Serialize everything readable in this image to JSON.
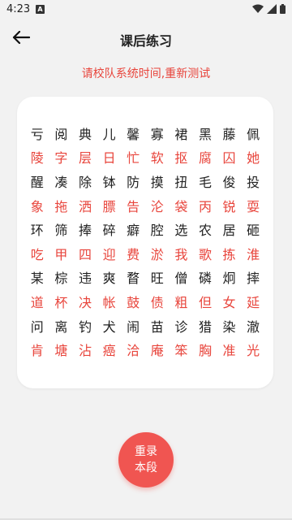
{
  "status_bar": {
    "time": "4:23",
    "notification_badge": "A",
    "icons": [
      "wifi-icon",
      "signal-icon",
      "battery-icon"
    ]
  },
  "header": {
    "title": "课后练习",
    "back_icon": "arrow-left-icon"
  },
  "instruction": "请校队系统时间,重新测试",
  "colors": {
    "accent": "#f05551",
    "red_text": "#e8453c",
    "dark_text": "#222222",
    "background": "#f2f2f2"
  },
  "character_rows": [
    {
      "style": "dark",
      "chars": [
        "亏",
        "阅",
        "典",
        "儿",
        "馨",
        "寡",
        "裙",
        "黑",
        "藤",
        "佩"
      ]
    },
    {
      "style": "red",
      "chars": [
        "陵",
        "字",
        "层",
        "日",
        "忙",
        "软",
        "抠",
        "腐",
        "囚",
        "她"
      ]
    },
    {
      "style": "dark",
      "chars": [
        "醒",
        "凑",
        "除",
        "钵",
        "防",
        "摸",
        "扭",
        "毛",
        "俊",
        "投"
      ]
    },
    {
      "style": "red",
      "chars": [
        "象",
        "拖",
        "洒",
        "膘",
        "告",
        "沦",
        "袋",
        "丙",
        "锐",
        "耍"
      ]
    },
    {
      "style": "dark",
      "chars": [
        "环",
        "筛",
        "捧",
        "碎",
        "癖",
        "腔",
        "选",
        "农",
        "居",
        "砸"
      ]
    },
    {
      "style": "red",
      "chars": [
        "吃",
        "甲",
        "四",
        "迎",
        "费",
        "淤",
        "我",
        "歌",
        "拣",
        "淮"
      ]
    },
    {
      "style": "dark",
      "chars": [
        "某",
        "棕",
        "违",
        "爽",
        "瞀",
        "旺",
        "僧",
        "磷",
        "炯",
        "摔"
      ]
    },
    {
      "style": "red",
      "chars": [
        "道",
        "杯",
        "决",
        "帐",
        "鼓",
        "债",
        "粗",
        "但",
        "女",
        "延"
      ]
    },
    {
      "style": "dark",
      "chars": [
        "问",
        "离",
        "钓",
        "犬",
        "闹",
        "苗",
        "诊",
        "猎",
        "染",
        "澈"
      ]
    },
    {
      "style": "red",
      "chars": [
        "肯",
        "塘",
        "沾",
        "癌",
        "洽",
        "庵",
        "笨",
        "胸",
        "准",
        "光"
      ]
    }
  ],
  "reset_button": {
    "line1": "重录",
    "line2": "本段"
  }
}
